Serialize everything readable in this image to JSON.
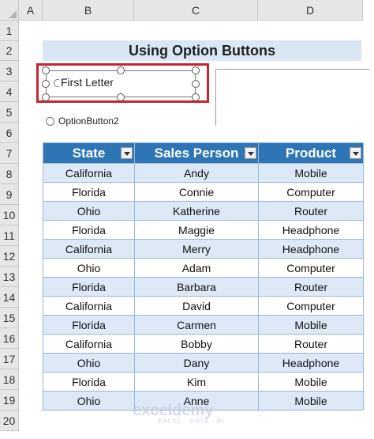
{
  "columns": [
    "A",
    "B",
    "C",
    "D"
  ],
  "rows": [
    "1",
    "2",
    "3",
    "4",
    "5",
    "6",
    "7",
    "8",
    "9",
    "10",
    "11",
    "12",
    "13",
    "14",
    "15",
    "16",
    "17",
    "18",
    "19",
    "20"
  ],
  "title": "Using Option Buttons",
  "option1_label": "First Letter",
  "option2_label": "OptionButton2",
  "table": {
    "headers": [
      "State",
      "Sales Person",
      "Product"
    ],
    "rows": [
      [
        "California",
        "Andy",
        "Mobile"
      ],
      [
        "Florida",
        "Connie",
        "Computer"
      ],
      [
        "Ohio",
        "Katherine",
        "Router"
      ],
      [
        "Florida",
        "Maggie",
        "Headphone"
      ],
      [
        "California",
        "Merry",
        "Headphone"
      ],
      [
        "Ohio",
        "Adam",
        "Computer"
      ],
      [
        "Florida",
        "Barbara",
        "Router"
      ],
      [
        "California",
        "David",
        "Computer"
      ],
      [
        "Florida",
        "Carmen",
        "Mobile"
      ],
      [
        "California",
        "Bobby",
        "Router"
      ],
      [
        "Ohio",
        "Dany",
        "Headphone"
      ],
      [
        "Florida",
        "Kim",
        "Mobile"
      ],
      [
        "Ohio",
        "Anne",
        "Mobile"
      ]
    ]
  },
  "watermark": "exceldemy",
  "watermark_sub": "EXCEL · DATA · BI",
  "colors": {
    "header_bg": "#2e75b6",
    "band_bg": "#dde9f7",
    "selection_border": "#c8262e",
    "title_band": "#d9e6f4"
  }
}
